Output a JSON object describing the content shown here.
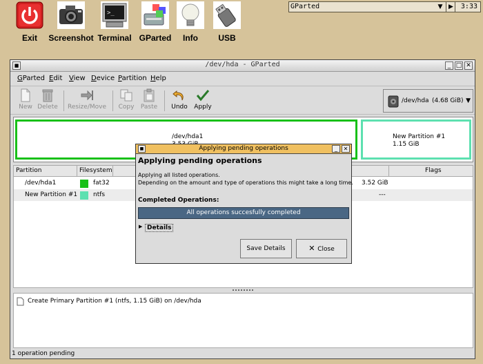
{
  "launchers": [
    {
      "label": "Exit",
      "icon": "power-icon"
    },
    {
      "label": "Screenshot",
      "icon": "camera-icon"
    },
    {
      "label": "Terminal",
      "icon": "terminal-icon"
    },
    {
      "label": "GParted",
      "icon": "gparted-icon"
    },
    {
      "label": "Info",
      "icon": "lightbulb-icon"
    },
    {
      "label": "USB",
      "icon": "usb-drive-icon"
    }
  ],
  "taskbar": {
    "window_name": "GParted",
    "clock": "3:33"
  },
  "window": {
    "title": "/dev/hda - GParted",
    "menu": [
      {
        "u": "G",
        "rest": "Parted"
      },
      {
        "u": "E",
        "rest": "dit"
      },
      {
        "u": "V",
        "rest": "iew"
      },
      {
        "u": "D",
        "rest": "evice"
      },
      {
        "u": "P",
        "rest": "artition"
      },
      {
        "u": "H",
        "rest": "elp"
      }
    ],
    "toolbar": {
      "new": "New",
      "delete": "Delete",
      "resize": "Resize/Move",
      "copy": "Copy",
      "paste": "Paste",
      "undo": "Undo",
      "apply": "Apply"
    },
    "device": {
      "name": "/dev/hda",
      "size": "(4.68 GiB)"
    },
    "partition_map": [
      {
        "name": "/dev/hda1",
        "size": "3.53 GiB"
      },
      {
        "name": "New Partition #1",
        "size": "1.15 GiB"
      }
    ],
    "columns": {
      "partition": "Partition",
      "filesystem": "Filesystem",
      "flags": "Flags"
    },
    "rows": [
      {
        "partition": "/dev/hda1",
        "filesystem": "fat32",
        "color": "#18c018",
        "size": "3.52 GiB"
      },
      {
        "partition": "New Partition #1",
        "filesystem": "ntfs",
        "color": "#5de0b0",
        "size": "---"
      }
    ],
    "operations": [
      "Create Primary Partition #1 (ntfs, 1.15 GiB) on /dev/hda"
    ],
    "status": "1 operation pending"
  },
  "dialog": {
    "title": "Applying pending operations",
    "heading": "Applying pending operations",
    "line1": "Applying all listed operations.",
    "line2": "Depending on the amount and type of operations this might take a long time.",
    "completed_label": "Completed Operations:",
    "progress_text": "All operations succesfully completed",
    "progress_fraction": 1.0,
    "details": "Details",
    "save_details": "Save Details",
    "close": "Close"
  },
  "colors": {
    "fat32": "#18c018",
    "ntfs": "#5de0b0",
    "dialog_title": "#f0c060",
    "progress": "#4a6784",
    "desktop": "#d6c39a"
  }
}
